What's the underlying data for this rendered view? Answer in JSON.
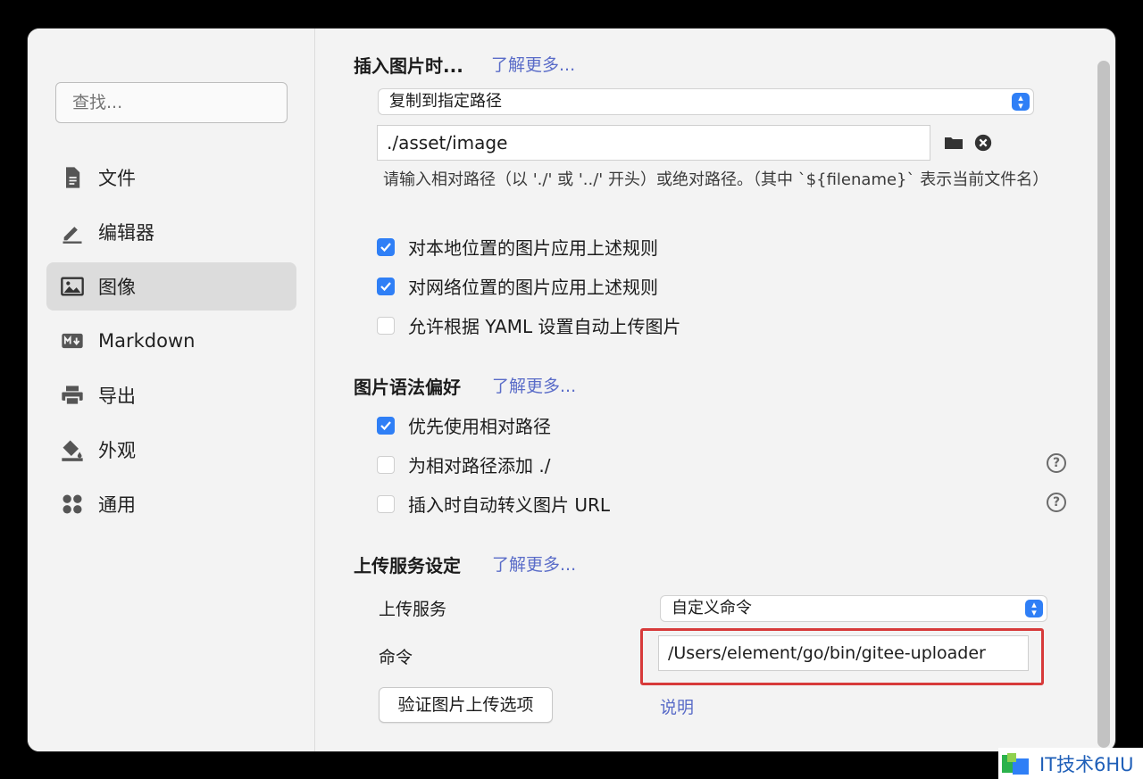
{
  "sidebar": {
    "search_placeholder": "查找...",
    "items": [
      {
        "label": "文件",
        "icon": "file-icon"
      },
      {
        "label": "编辑器",
        "icon": "pencil-icon"
      },
      {
        "label": "图像",
        "icon": "image-icon",
        "active": true
      },
      {
        "label": "Markdown",
        "icon": "markdown-icon"
      },
      {
        "label": "导出",
        "icon": "printer-icon"
      },
      {
        "label": "外观",
        "icon": "paint-bucket-icon"
      },
      {
        "label": "通用",
        "icon": "apps-icon"
      }
    ]
  },
  "insert": {
    "title": "插入图片时...",
    "learn_more": "了解更多...",
    "action_selected": "复制到指定路径",
    "path_value": "./asset/image",
    "hint": "请输入相对路径（以 './' 或 '../' 开头）或绝对路径。（其中 `${filename}` 表示当前文件名）",
    "checks": [
      {
        "label": "对本地位置的图片应用上述规则",
        "checked": true
      },
      {
        "label": "对网络位置的图片应用上述规则",
        "checked": true
      },
      {
        "label": "允许根据 YAML 设置自动上传图片",
        "checked": false
      }
    ]
  },
  "syntax": {
    "title": "图片语法偏好",
    "learn_more": "了解更多...",
    "checks": [
      {
        "label": "优先使用相对路径",
        "checked": true
      },
      {
        "label": "为相对路径添加 ./",
        "checked": false
      },
      {
        "label": "插入时自动转义图片 URL",
        "checked": false
      }
    ],
    "help_symbol": "?"
  },
  "upload": {
    "title": "上传服务设定",
    "learn_more": "了解更多...",
    "service_label": "上传服务",
    "service_selected": "自定义命令",
    "command_label": "命令",
    "command_value": "/Users/element/go/bin/gitee-uploader",
    "verify_button": "验证图片上传选项",
    "explain_link": "说明"
  },
  "watermark": {
    "text": "IT技术6HU"
  },
  "colors": {
    "accent": "#2f7ff6",
    "link": "#5a6cc8",
    "highlight": "#d73a3a"
  }
}
